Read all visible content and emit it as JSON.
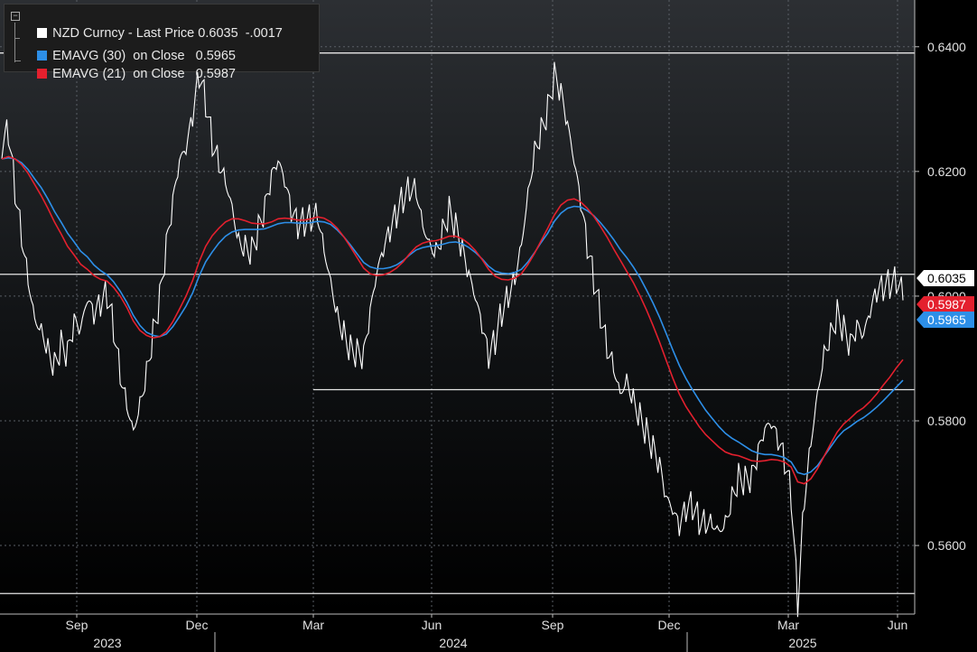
{
  "legend": {
    "items": [
      {
        "name": "NZD Curncy",
        "desc": "- Last Price",
        "value": "0.6035",
        "change": "-.0017",
        "color": "#ffffff"
      },
      {
        "name": "EMAVG (30)",
        "desc": "on Close",
        "value": "0.5965",
        "change": "",
        "color": "#2d8fe8"
      },
      {
        "name": "EMAVG (21)",
        "desc": "on Close",
        "value": "0.5987",
        "change": "",
        "color": "#e4202e"
      }
    ]
  },
  "chart_data": {
    "type": "line",
    "x_tick_labels": [
      "Sep",
      "Dec",
      "Mar",
      "Jun",
      "Sep",
      "Dec",
      "Mar",
      "Jun"
    ],
    "year_labels": [
      "2023",
      "2024",
      "2025"
    ],
    "y_tick_labels": [
      "0.5600",
      "0.5800",
      "0.6000",
      "0.6200",
      "0.6400"
    ],
    "y_ticks": [
      0.56,
      0.58,
      0.6,
      0.62,
      0.64
    ],
    "ylim": [
      0.549,
      0.6475
    ],
    "horizontal_lines": [
      0.639,
      0.6035,
      0.585,
      0.5523
    ],
    "last_value_labels": [
      {
        "text": "0.6035",
        "value": 0.6035,
        "bg": "#ffffff",
        "fg": "#000000"
      },
      {
        "text": "0.5987",
        "value": 0.5987,
        "bg": "#e4202e",
        "fg": "#ffffff"
      },
      {
        "text": "0.5965",
        "value": 0.5965,
        "bg": "#2d8fe8",
        "fg": "#ffffff"
      }
    ],
    "series": [
      {
        "name": "NZD Curncy - Last Price",
        "color": "#ffffff",
        "values": [
          0.622,
          0.626,
          0.618,
          0.612,
          0.606,
          0.6,
          0.598,
          0.594,
          0.59,
          0.592,
          0.589,
          0.593,
          0.591,
          0.596,
          0.594,
          0.597,
          0.6,
          0.596,
          0.59,
          0.586,
          0.582,
          0.586,
          0.59,
          0.595,
          0.599,
          0.606,
          0.612,
          0.618,
          0.62,
          0.626,
          0.634,
          0.631,
          0.626,
          0.624,
          0.622,
          0.618,
          0.612,
          0.61,
          0.608,
          0.61,
          0.612,
          0.616,
          0.618,
          0.615,
          0.611,
          0.61,
          0.612,
          0.614,
          0.616,
          0.611,
          0.606,
          0.6,
          0.596,
          0.592,
          0.59,
          0.588,
          0.594,
          0.6,
          0.604,
          0.608,
          0.612,
          0.616,
          0.619,
          0.62,
          0.615,
          0.612,
          0.61,
          0.612,
          0.614,
          0.61,
          0.605,
          0.6,
          0.596,
          0.592,
          0.588,
          0.592,
          0.598,
          0.602,
          0.606,
          0.612,
          0.62,
          0.626,
          0.628,
          0.63,
          0.634,
          0.63,
          0.624,
          0.618,
          0.612,
          0.606,
          0.602,
          0.598,
          0.594,
          0.592,
          0.588,
          0.59,
          0.586,
          0.582,
          0.578,
          0.574,
          0.57,
          0.564,
          0.562,
          0.56,
          0.564,
          0.566,
          0.565,
          0.566,
          0.567,
          0.566,
          0.567,
          0.57,
          0.572,
          0.57,
          0.569,
          0.572,
          0.575,
          0.576,
          0.574,
          0.572,
          0.568,
          0.552,
          0.57,
          0.58,
          0.588,
          0.594,
          0.596,
          0.598,
          0.594,
          0.59,
          0.592,
          0.59,
          0.594,
          0.598,
          0.6,
          0.602,
          0.604,
          0.6035
        ]
      },
      {
        "name": "EMAVG (30) on Close",
        "color": "#2d8fe8",
        "values": [
          0.622,
          0.6222,
          0.622,
          0.6214,
          0.6203,
          0.6188,
          0.6174,
          0.6156,
          0.6136,
          0.6119,
          0.6101,
          0.6087,
          0.6072,
          0.6063,
          0.605,
          0.6041,
          0.6034,
          0.6023,
          0.6008,
          0.599,
          0.5969,
          0.5953,
          0.5942,
          0.5937,
          0.5935,
          0.5939,
          0.5951,
          0.5967,
          0.5984,
          0.6005,
          0.6032,
          0.6055,
          0.6071,
          0.6085,
          0.6096,
          0.6103,
          0.6106,
          0.6107,
          0.6107,
          0.6107,
          0.6108,
          0.6112,
          0.6116,
          0.6118,
          0.6118,
          0.6117,
          0.6117,
          0.6118,
          0.612,
          0.6119,
          0.6115,
          0.6106,
          0.6095,
          0.6082,
          0.6068,
          0.6054,
          0.6047,
          0.6044,
          0.6044,
          0.6046,
          0.605,
          0.6057,
          0.6066,
          0.6074,
          0.6078,
          0.608,
          0.6081,
          0.6083,
          0.6086,
          0.6087,
          0.6084,
          0.6078,
          0.607,
          0.606,
          0.6048,
          0.604,
          0.6037,
          0.6036,
          0.6038,
          0.6043,
          0.6055,
          0.607,
          0.6086,
          0.6101,
          0.612,
          0.6133,
          0.6141,
          0.6144,
          0.6143,
          0.6137,
          0.6129,
          0.6118,
          0.6105,
          0.6091,
          0.6075,
          0.6062,
          0.6047,
          0.603,
          0.601,
          0.5989,
          0.5966,
          0.594,
          0.5914,
          0.5889,
          0.5868,
          0.585,
          0.5833,
          0.5817,
          0.5804,
          0.5791,
          0.578,
          0.5772,
          0.5766,
          0.5759,
          0.5752,
          0.5748,
          0.5746,
          0.5746,
          0.5744,
          0.5741,
          0.5734,
          0.5717,
          0.5714,
          0.5718,
          0.5728,
          0.5743,
          0.5758,
          0.5773,
          0.5784,
          0.5791,
          0.5799,
          0.5805,
          0.5813,
          0.5822,
          0.5832,
          0.5843,
          0.5854,
          0.5865
        ]
      },
      {
        "name": "EMAVG (21) on Close",
        "color": "#e4202e",
        "values": [
          0.622,
          0.6224,
          0.622,
          0.6211,
          0.6197,
          0.6179,
          0.6161,
          0.6141,
          0.6119,
          0.61,
          0.608,
          0.6066,
          0.6051,
          0.6043,
          0.6033,
          0.6027,
          0.6024,
          0.6014,
          0.6,
          0.5982,
          0.596,
          0.5945,
          0.5937,
          0.5933,
          0.5935,
          0.5943,
          0.5959,
          0.5979,
          0.6,
          0.6025,
          0.6055,
          0.608,
          0.6097,
          0.6109,
          0.6119,
          0.6124,
          0.6124,
          0.6121,
          0.6117,
          0.6116,
          0.6116,
          0.6119,
          0.6124,
          0.6125,
          0.6124,
          0.6122,
          0.6122,
          0.6124,
          0.6127,
          0.6125,
          0.6119,
          0.6109,
          0.6095,
          0.6079,
          0.6062,
          0.6045,
          0.6036,
          0.6033,
          0.6034,
          0.6038,
          0.6045,
          0.6055,
          0.6068,
          0.6079,
          0.6085,
          0.6088,
          0.6089,
          0.6092,
          0.6096,
          0.6096,
          0.6092,
          0.6084,
          0.6073,
          0.6059,
          0.6043,
          0.6032,
          0.6027,
          0.6026,
          0.6029,
          0.6036,
          0.6051,
          0.6069,
          0.6089,
          0.6109,
          0.613,
          0.6146,
          0.6154,
          0.6156,
          0.6151,
          0.6141,
          0.6128,
          0.6112,
          0.6095,
          0.6076,
          0.6058,
          0.604,
          0.6022,
          0.6001,
          0.5978,
          0.5953,
          0.5926,
          0.5897,
          0.5869,
          0.5843,
          0.5823,
          0.5807,
          0.5791,
          0.5778,
          0.5768,
          0.5758,
          0.575,
          0.5746,
          0.5744,
          0.574,
          0.5736,
          0.5735,
          0.5736,
          0.5738,
          0.5737,
          0.5734,
          0.5726,
          0.5702,
          0.5699,
          0.5707,
          0.5723,
          0.5743,
          0.5763,
          0.5782,
          0.5795,
          0.5804,
          0.5814,
          0.5821,
          0.5831,
          0.5843,
          0.5857,
          0.587,
          0.5885,
          0.5898
        ]
      }
    ]
  }
}
